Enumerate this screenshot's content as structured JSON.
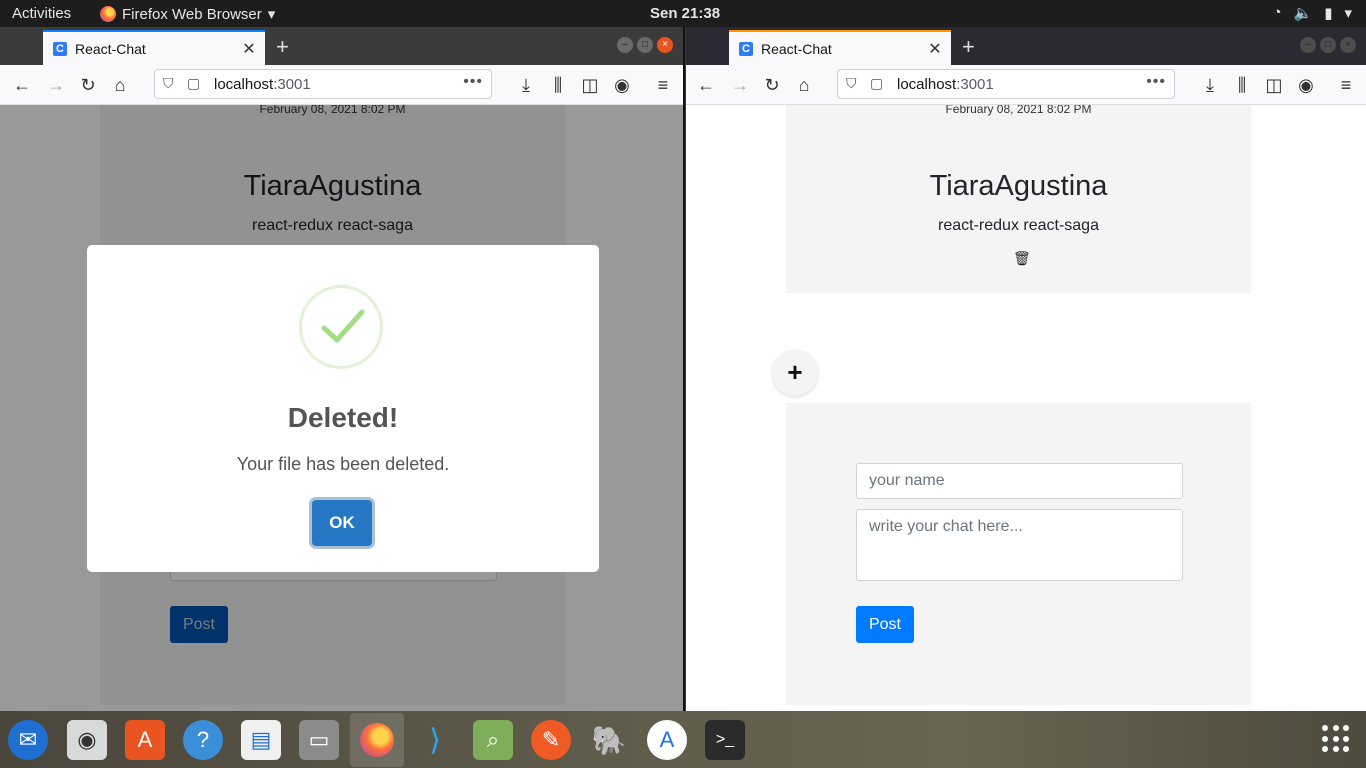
{
  "topbar": {
    "activities": "Activities",
    "app_name": "Firefox Web Browser",
    "clock": "Sen 21:38"
  },
  "browser": {
    "tab_title": "React-Chat",
    "tab_favicon": "C",
    "url_host": "localhost",
    "url_port": ":3001",
    "accent_left": "#0a84ff",
    "accent_right": "#ff9400"
  },
  "page": {
    "message": {
      "date": "February 08, 2021 8:02 PM",
      "name": "TiaraAgustina",
      "text": "react-redux react-saga"
    },
    "add_button": "+",
    "form": {
      "name_placeholder": "your name",
      "chat_placeholder": "write your chat here...",
      "post_label": "Post"
    }
  },
  "dialog": {
    "title": "Deleted!",
    "text": "Your file has been deleted.",
    "ok_label": "OK",
    "success_color": "#a5dc86"
  },
  "dock": {
    "items": [
      "thunderbird-icon",
      "rhythmbox-icon",
      "software-icon",
      "help-icon",
      "writer-icon",
      "files-icon",
      "firefox-icon",
      "vscode-icon",
      "image-viewer-icon",
      "postman-icon",
      "postgres-icon",
      "android-studio-icon",
      "terminal-icon"
    ]
  }
}
